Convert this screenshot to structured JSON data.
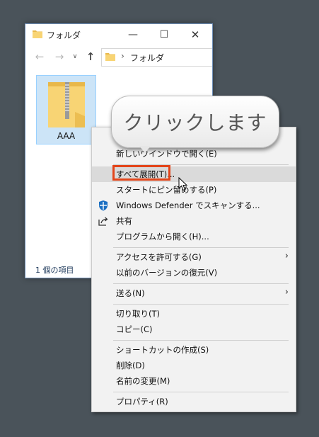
{
  "window": {
    "title": "フォルダ",
    "address": "フォルダ",
    "nav_back": "←",
    "nav_forward": "→",
    "nav_recent": "∨",
    "nav_up": "↑",
    "min_glyph": "—",
    "max_glyph": "☐",
    "close_glyph": "✕",
    "address_chevron": "›"
  },
  "files": [
    {
      "name": "AAA",
      "icon": "zip-folder-icon",
      "selected": true
    }
  ],
  "status_bar": {
    "text": "1 個の項目"
  },
  "context_menu": {
    "items": [
      {
        "label": "新しいウインドウで開く(E)"
      },
      {
        "label": "すべて展開(T)...",
        "highlighted": true
      },
      {
        "label": "スタートにピン留めする(P)"
      },
      {
        "label": "Windows Defender でスキャンする...",
        "icon": "windows-defender-icon"
      },
      {
        "label": "共有",
        "icon": "share-icon"
      },
      {
        "label": "プログラムから開く(H)..."
      },
      {
        "label": "アクセスを許可する(G)",
        "submenu": true
      },
      {
        "label": "以前のバージョンの復元(V)"
      },
      {
        "label": "送る(N)",
        "submenu": true
      },
      {
        "label": "切り取り(T)"
      },
      {
        "label": "コピー(C)"
      },
      {
        "label": "ショートカットの作成(S)"
      },
      {
        "label": "削除(D)"
      },
      {
        "label": "名前の変更(M)"
      },
      {
        "label": "プロパティ(R)"
      }
    ],
    "submenu_glyph": "›"
  },
  "callout": {
    "text": "クリックします"
  },
  "colors": {
    "desktop": "#4a535a",
    "menu_bg": "#f2f2f2",
    "highlight": "#dadada",
    "annotation_red": "#e3451a",
    "folder_yellow": "#f8c85f",
    "selection_bg": "#cce4f7"
  }
}
